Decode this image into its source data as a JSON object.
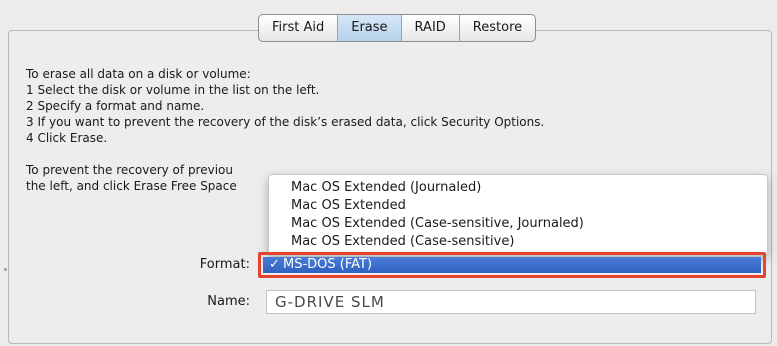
{
  "tabs": [
    {
      "label": "First Aid"
    },
    {
      "label": "Erase"
    },
    {
      "label": "RAID"
    },
    {
      "label": "Restore"
    }
  ],
  "selected_tab": "Erase",
  "instructions": {
    "line1": "To erase all data on a disk or volume:",
    "line2": "1 Select the disk or volume in the list on the left.",
    "line3": "2 Specify a format and name.",
    "line4": "3 If you want to prevent the recovery of the disk’s erased data, click Security Options.",
    "line5": "4 Click Erase.",
    "para2_part1": "To prevent the recovery of previou",
    "para2_part2": "the left, and click Erase Free Space"
  },
  "format_menu": {
    "options": [
      "Mac OS Extended (Journaled)",
      "Mac OS Extended",
      "Mac OS Extended (Case-sensitive, Journaled)",
      "Mac OS Extended (Case-sensitive)"
    ],
    "selected": "MS-DOS (FAT)",
    "check_mark": "✓"
  },
  "labels": {
    "format": "Format:",
    "name": "Name:"
  },
  "name_field": {
    "value": "G-DRIVE SLM"
  },
  "colors": {
    "highlight": "#e5452d",
    "selection": "#3a6fd0"
  }
}
